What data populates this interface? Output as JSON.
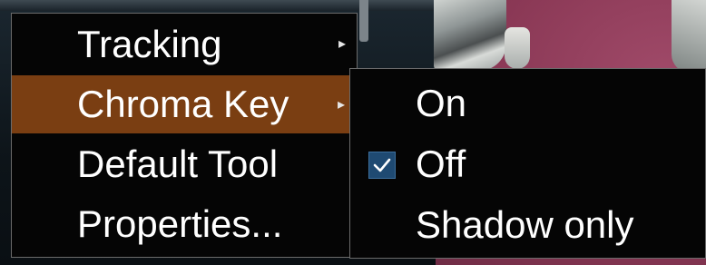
{
  "main_menu": {
    "items": [
      {
        "label": "Tracking",
        "has_submenu": true,
        "highlighted": false
      },
      {
        "label": "Chroma Key",
        "has_submenu": true,
        "highlighted": true
      },
      {
        "label": "Default Tool",
        "has_submenu": false,
        "highlighted": false
      },
      {
        "label": "Properties...",
        "has_submenu": false,
        "highlighted": false
      }
    ],
    "submenu_arrow_icon": "chevron-right-icon"
  },
  "chroma_key_submenu": {
    "items": [
      {
        "label": "On",
        "checked": false
      },
      {
        "label": "Off",
        "checked": true
      },
      {
        "label": "Shadow only",
        "checked": false
      }
    ],
    "check_icon": "checkmark-icon"
  },
  "colors": {
    "menu_background": "#050505",
    "menu_border": "#6b6b6b",
    "highlight": "#7a3e12",
    "check_background": "#1f4a72",
    "text": "#ffffff"
  }
}
